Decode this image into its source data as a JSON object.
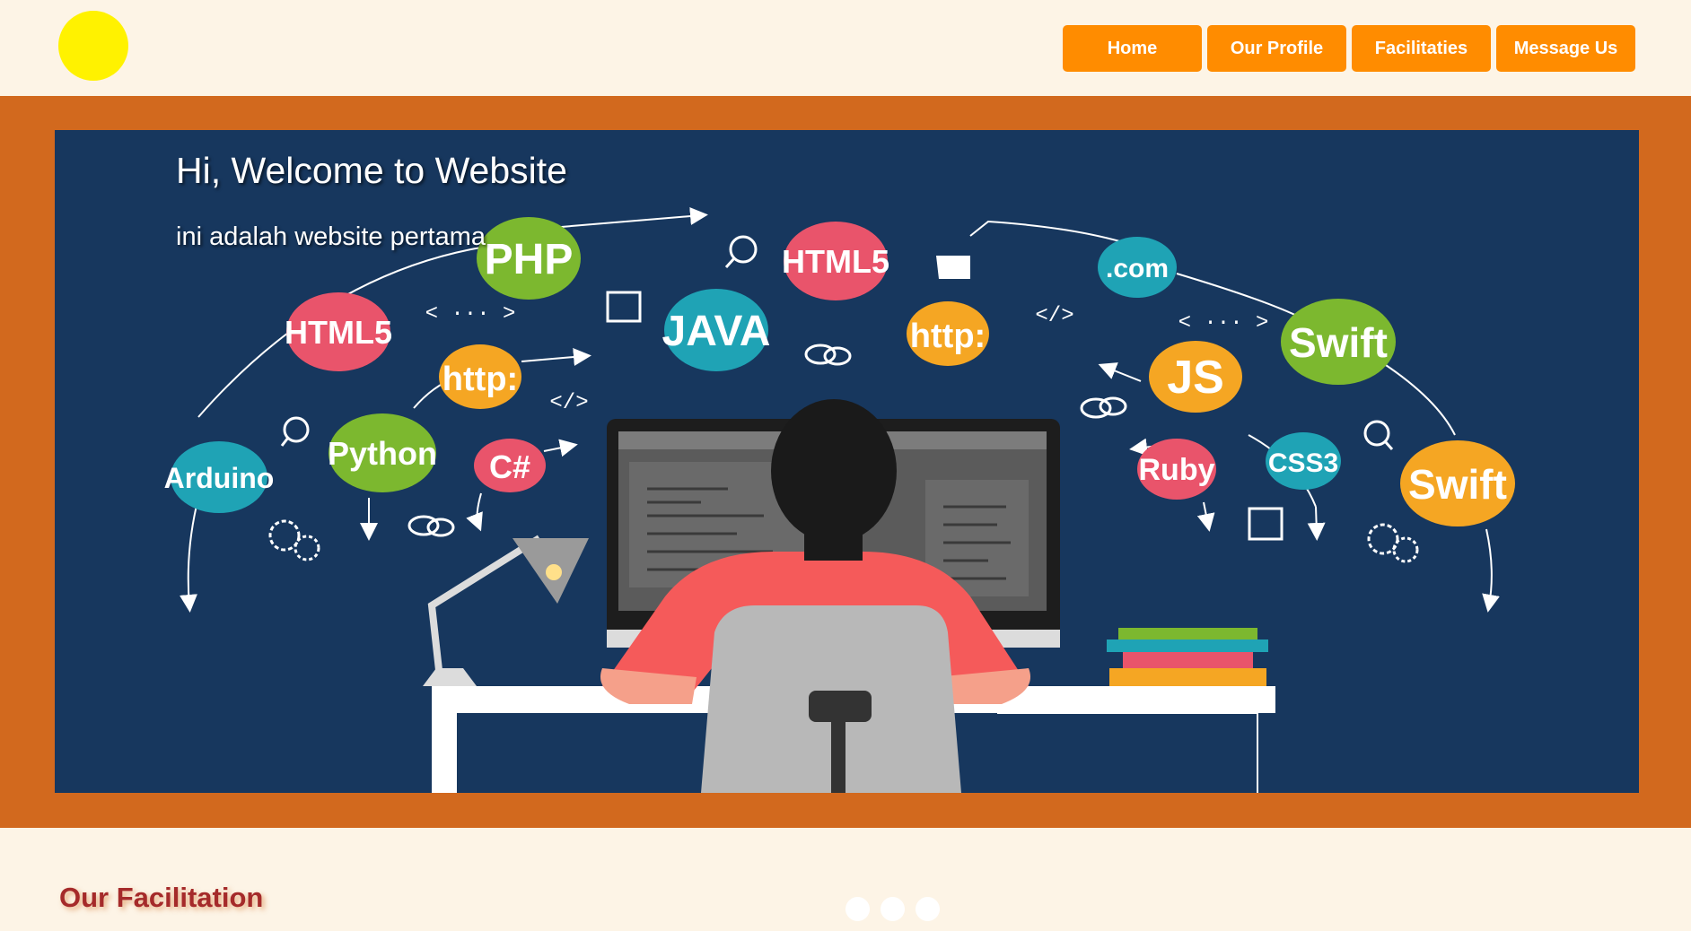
{
  "header": {
    "nav": [
      {
        "label": "Home"
      },
      {
        "label": "Our Profile"
      },
      {
        "label": "Facilitaties"
      },
      {
        "label": "Message Us"
      }
    ]
  },
  "hero": {
    "title": "Hi, Welcome to Website",
    "subtitle": "ini adalah website pertama",
    "bubbles": [
      {
        "label": "PHP",
        "color": "#7cb82f"
      },
      {
        "label": "HTML5",
        "color": "#e9546b"
      },
      {
        "label": "HTML5",
        "color": "#e9546b"
      },
      {
        "label": "JAVA",
        "color": "#1fa3b5"
      },
      {
        "label": "http:",
        "color": "#f5a623"
      },
      {
        "label": "http:",
        "color": "#f5a623"
      },
      {
        "label": ".com",
        "color": "#1fa3b5"
      },
      {
        "label": "Swift",
        "color": "#7cb82f"
      },
      {
        "label": "Swift",
        "color": "#f5a623"
      },
      {
        "label": "JS",
        "color": "#f5a623"
      },
      {
        "label": "Arduino",
        "color": "#1fa3b5"
      },
      {
        "label": "Python",
        "color": "#7cb82f"
      },
      {
        "label": "C#",
        "color": "#e9546b"
      },
      {
        "label": "Ruby",
        "color": "#e9546b"
      },
      {
        "label": "CSS3",
        "color": "#1fa3b5"
      }
    ],
    "code_tags": [
      "< ··· >",
      "</>",
      "</>",
      "< ··· >"
    ]
  },
  "section": {
    "title": "Our Facilitation"
  },
  "colors": {
    "page_bg": "#fdf4e6",
    "logo": "#fff200",
    "nav_button": "#ff8c00",
    "hero_frame": "#d2691e",
    "hero_panel": "#17375e",
    "section_title": "#a52a2a"
  }
}
